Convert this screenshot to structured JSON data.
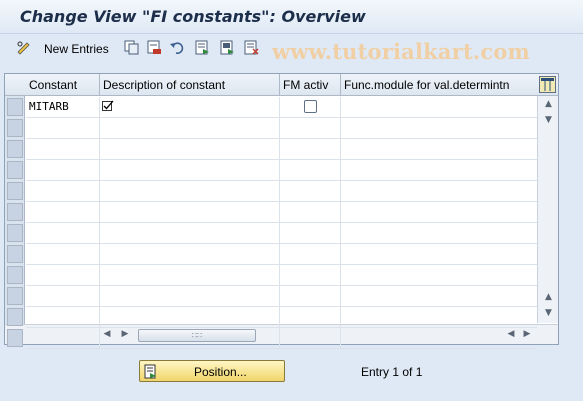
{
  "window": {
    "title": "Change View \"FI constants\": Overview"
  },
  "toolbar": {
    "new_entries_label": "New Entries",
    "watermark": "www.tutorialkart.com",
    "icons": [
      "pen-glasses-icon",
      "copy-icon",
      "delete-icon",
      "undo-icon",
      "select-all-icon",
      "select-block-icon",
      "deselect-all-icon"
    ]
  },
  "table": {
    "columns": [
      "Constant",
      "Description of constant",
      "FM activ",
      "Func.module for val.determintn"
    ],
    "rows": [
      {
        "constant": "MITARB",
        "description_icon": "checkmark-icon",
        "fm_active": false,
        "func_module": ""
      }
    ],
    "empty_rows": 11
  },
  "footer": {
    "position_button_label": "Position...",
    "entry_text": "Entry 1 of 1"
  }
}
